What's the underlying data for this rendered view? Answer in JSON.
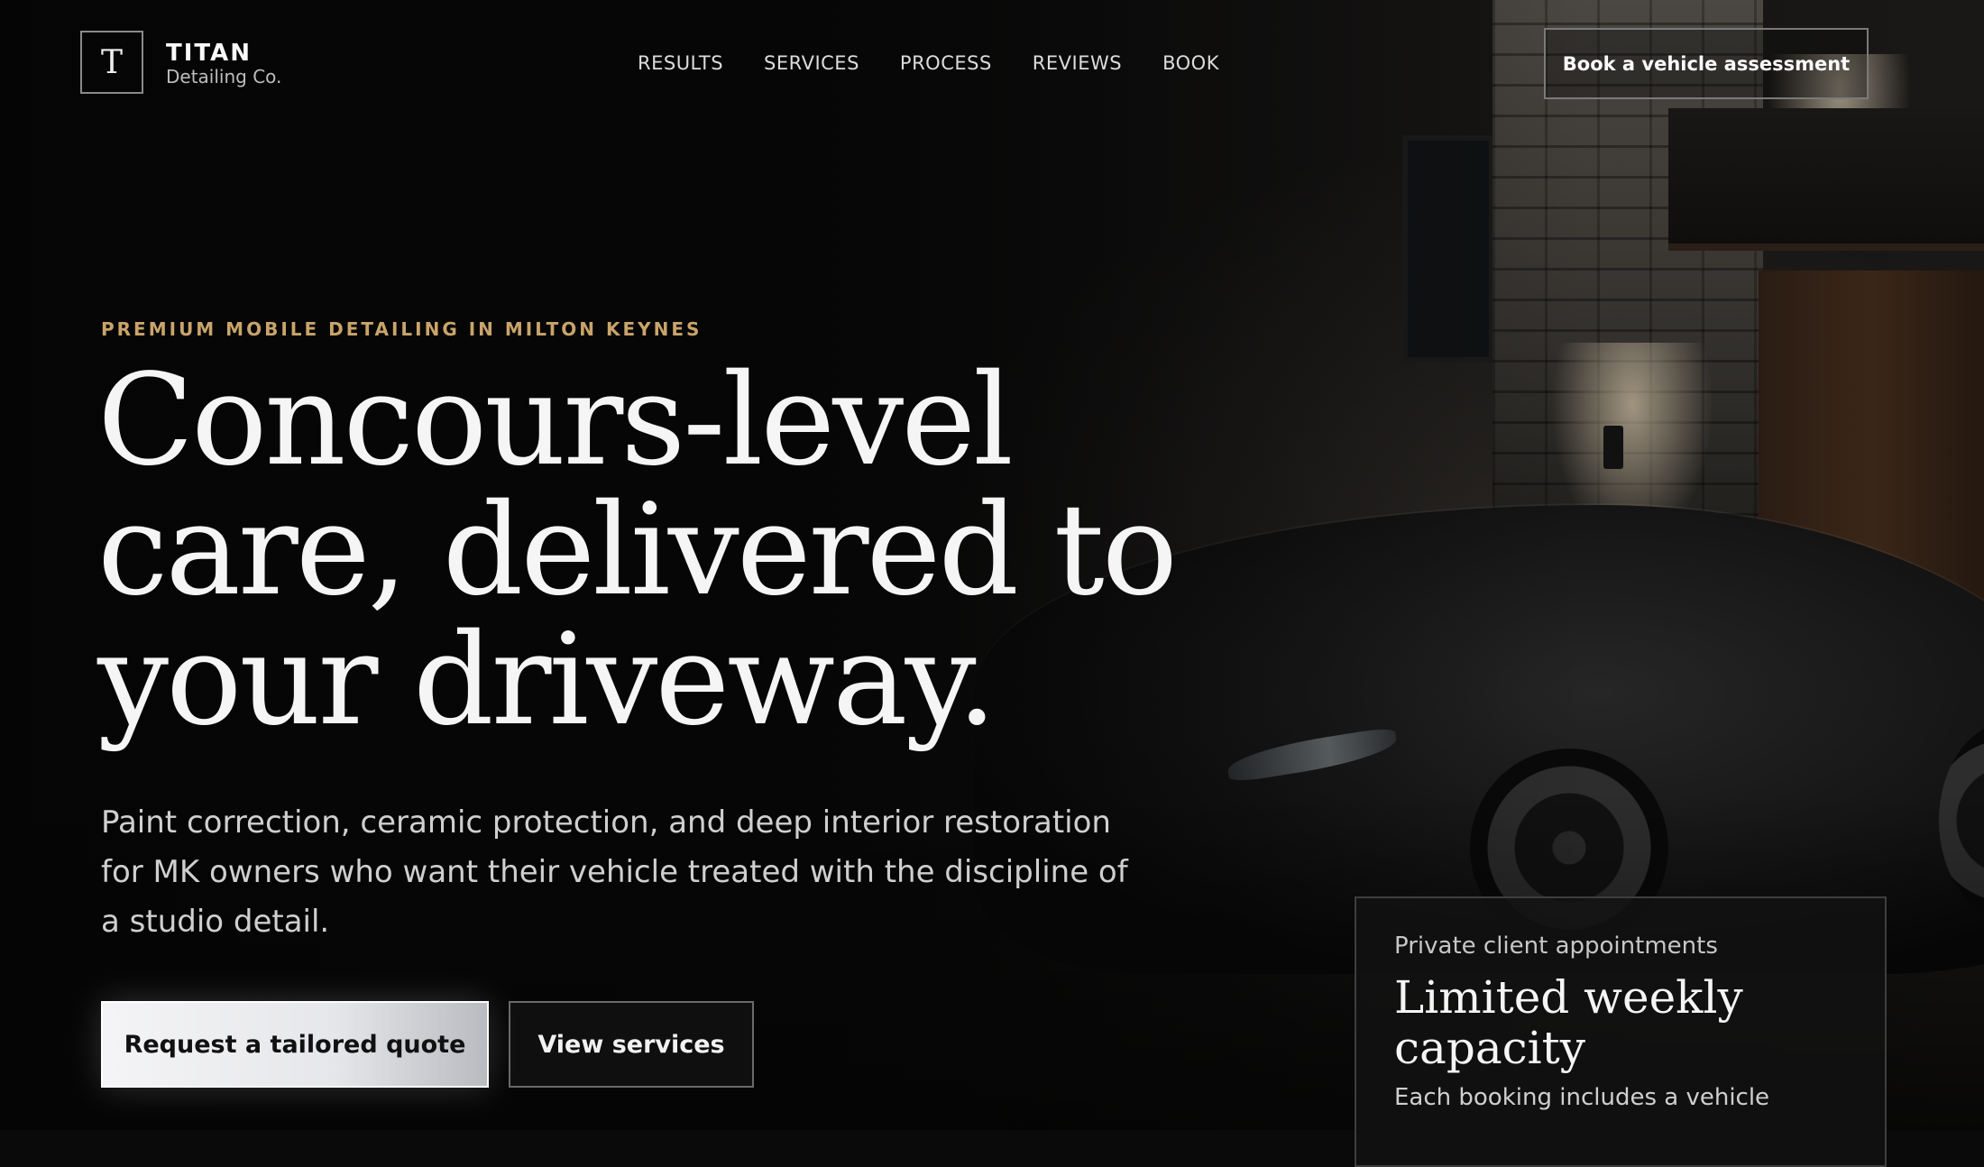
{
  "brand": {
    "monogram": "T",
    "name": "TITAN",
    "subtitle": "Detailing Co."
  },
  "nav": {
    "items": [
      "RESULTS",
      "SERVICES",
      "PROCESS",
      "REVIEWS",
      "BOOK"
    ]
  },
  "header": {
    "cta_label": "Book a vehicle assessment"
  },
  "hero": {
    "eyebrow": "PREMIUM MOBILE DETAILING IN MILTON KEYNES",
    "headline_lines": [
      "Concours-level",
      "care, delivered to",
      "your driveway."
    ],
    "lead": "Paint correction, ceramic protection, and deep interior restoration for MK owners who want their vehicle treated with the discipline of a studio detail.",
    "primary_button": "Request a tailored quote",
    "secondary_button": "View services"
  },
  "card": {
    "kicker": "Private client appointments",
    "title": "Limited weekly capacity",
    "body": "Each booking includes a vehicle"
  },
  "colors": {
    "accent_gold": "#c9a46a",
    "background": "#0a0a0a",
    "text": "#f5f5f5"
  }
}
